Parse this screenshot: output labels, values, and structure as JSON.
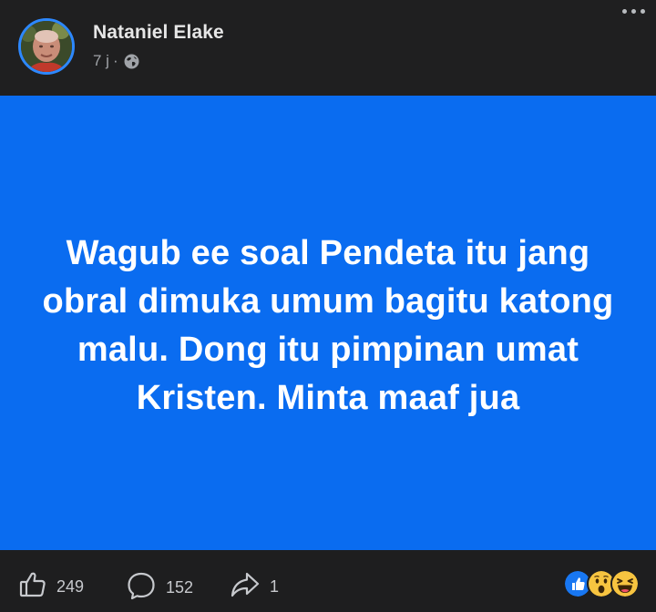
{
  "header": {
    "author_name": "Nataniel Elake",
    "time": "7 j",
    "separator": "·",
    "privacy_icon": "globe-icon",
    "more_icon": "more-dots-icon"
  },
  "post": {
    "background_color": "#0a6cf0",
    "text_color": "#ffffff",
    "text": "Wagub ee soal Pendeta itu jang obral dimuka umum bagitu katong malu. Dong itu pimpinan umat Kristen. Minta maaf jua"
  },
  "footer": {
    "like_count": "249",
    "comment_count": "152",
    "share_count": "1",
    "reactions": [
      "like-reaction-icon",
      "wow-reaction-icon",
      "haha-reaction-icon"
    ]
  },
  "colors": {
    "background": "#1e1e1f",
    "accent_blue": "#2d88ff",
    "muted_text": "#a0a3a8"
  }
}
